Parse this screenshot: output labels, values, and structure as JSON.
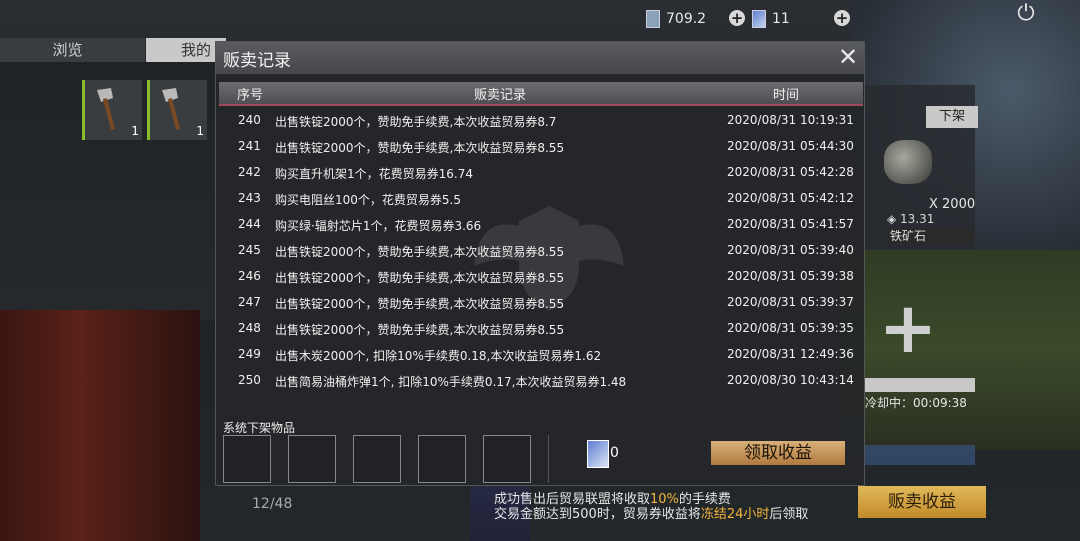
{
  "top_bar": {
    "currency1_value": "709.2",
    "currency2_value": "11"
  },
  "tabs": {
    "browse": "浏览",
    "mine": "我的"
  },
  "inventory": [
    {
      "qty": "1"
    },
    {
      "qty": "1"
    }
  ],
  "side_panel": {
    "delist_label": "下架",
    "item_qty": "X 2000",
    "item_price": "13.31",
    "item_name": "铁矿石",
    "cooldown": "冷却中：00:09:38",
    "sell_income_label": "贩卖收益"
  },
  "notice": {
    "line1_a": "成功售出后贸易联盟将收取",
    "line1_b": "10%",
    "line1_c": "的手续费",
    "line2_a": "交易金额达到500时，贸易券收益将",
    "line2_b": "冻结24小时",
    "line2_c": "后领取"
  },
  "page_count": "12/48",
  "modal": {
    "title": "贩卖记录",
    "headers": {
      "no": "序号",
      "record": "贩卖记录",
      "time": "时间"
    },
    "rows": [
      {
        "no": "240",
        "record": "出售铁锭2000个，赞助免手续费,本次收益贸易券8.7",
        "time": "2020/08/31 10:19:31"
      },
      {
        "no": "241",
        "record": "出售铁锭2000个，赞助免手续费,本次收益贸易券8.55",
        "time": "2020/08/31 05:44:30"
      },
      {
        "no": "242",
        "record": "购买直升机架1个，花费贸易券16.74",
        "time": "2020/08/31 05:42:28"
      },
      {
        "no": "243",
        "record": "购买电阻丝100个，花费贸易券5.5",
        "time": "2020/08/31 05:42:12"
      },
      {
        "no": "244",
        "record": "购买绿·辐射芯片1个，花费贸易券3.66",
        "time": "2020/08/31 05:41:57"
      },
      {
        "no": "245",
        "record": "出售铁锭2000个，赞助免手续费,本次收益贸易券8.55",
        "time": "2020/08/31 05:39:40"
      },
      {
        "no": "246",
        "record": "出售铁锭2000个，赞助免手续费,本次收益贸易券8.55",
        "time": "2020/08/31 05:39:38"
      },
      {
        "no": "247",
        "record": "出售铁锭2000个，赞助免手续费,本次收益贸易券8.55",
        "time": "2020/08/31 05:39:37"
      },
      {
        "no": "248",
        "record": "出售铁锭2000个，赞助免手续费,本次收益贸易券8.55",
        "time": "2020/08/31 05:39:35"
      },
      {
        "no": "249",
        "record": "出售木炭2000个, 扣除10%手续费0.18,本次收益贸易券1.62",
        "time": "2020/08/31 12:49:36"
      },
      {
        "no": "250",
        "record": "出售简易油桶炸弹1个, 扣除10%手续费0.17,本次收益贸易券1.48",
        "time": "2020/08/30 10:43:14"
      }
    ],
    "system_delisted_label": "系统下架物品",
    "ticket_count": "0",
    "claim_label": "领取收益"
  }
}
